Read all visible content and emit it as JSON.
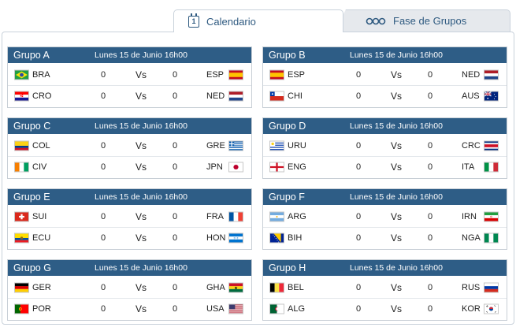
{
  "tabs": {
    "calendar": "Calendario",
    "groups": "Fase de Grupos"
  },
  "vs": "Vs",
  "groups": [
    {
      "name": "Grupo A",
      "date": "Lunes 15 de Junio 16h00",
      "matches": [
        {
          "home": "BRA",
          "home_flag": "brazil-flag-icon",
          "home_score": "0",
          "away_score": "0",
          "away": "ESP",
          "away_flag": "spain-flag-icon"
        },
        {
          "home": "CRO",
          "home_flag": "croatia-flag-icon",
          "home_score": "0",
          "away_score": "0",
          "away": "NED",
          "away_flag": "netherlands-flag-icon"
        }
      ]
    },
    {
      "name": "Grupo B",
      "date": "Lunes 15 de Junio 16h00",
      "matches": [
        {
          "home": "ESP",
          "home_flag": "spain-flag-icon",
          "home_score": "0",
          "away_score": "0",
          "away": "NED",
          "away_flag": "netherlands-flag-icon"
        },
        {
          "home": "CHI",
          "home_flag": "chile-flag-icon",
          "home_score": "0",
          "away_score": "0",
          "away": "AUS",
          "away_flag": "australia-flag-icon"
        }
      ]
    },
    {
      "name": "Grupo C",
      "date": "Lunes 15 de Junio 16h00",
      "matches": [
        {
          "home": "COL",
          "home_flag": "colombia-flag-icon",
          "home_score": "0",
          "away_score": "0",
          "away": "GRE",
          "away_flag": "greece-flag-icon"
        },
        {
          "home": "CIV",
          "home_flag": "ivory-coast-flag-icon",
          "home_score": "0",
          "away_score": "0",
          "away": "JPN",
          "away_flag": "japan-flag-icon"
        }
      ]
    },
    {
      "name": "Grupo D",
      "date": "Lunes 15 de Junio 16h00",
      "matches": [
        {
          "home": "URU",
          "home_flag": "uruguay-flag-icon",
          "home_score": "0",
          "away_score": "0",
          "away": "CRC",
          "away_flag": "costa-rica-flag-icon"
        },
        {
          "home": "ENG",
          "home_flag": "england-flag-icon",
          "home_score": "0",
          "away_score": "0",
          "away": "ITA",
          "away_flag": "italy-flag-icon"
        }
      ]
    },
    {
      "name": "Grupo E",
      "date": "Lunes 15 de Junio 16h00",
      "matches": [
        {
          "home": "SUI",
          "home_flag": "switzerland-flag-icon",
          "home_score": "0",
          "away_score": "0",
          "away": "FRA",
          "away_flag": "france-flag-icon"
        },
        {
          "home": "ECU",
          "home_flag": "ecuador-flag-icon",
          "home_score": "0",
          "away_score": "0",
          "away": "HON",
          "away_flag": "honduras-flag-icon"
        }
      ]
    },
    {
      "name": "Grupo F",
      "date": "Lunes 15 de Junio 16h00",
      "matches": [
        {
          "home": "ARG",
          "home_flag": "argentina-flag-icon",
          "home_score": "0",
          "away_score": "0",
          "away": "IRN",
          "away_flag": "iran-flag-icon"
        },
        {
          "home": "BIH",
          "home_flag": "bosnia-flag-icon",
          "home_score": "0",
          "away_score": "0",
          "away": "NGA",
          "away_flag": "nigeria-flag-icon"
        }
      ]
    },
    {
      "name": "Grupo G",
      "date": "Lunes 15 de Junio 16h00",
      "matches": [
        {
          "home": "GER",
          "home_flag": "germany-flag-icon",
          "home_score": "0",
          "away_score": "0",
          "away": "GHA",
          "away_flag": "ghana-flag-icon"
        },
        {
          "home": "POR",
          "home_flag": "portugal-flag-icon",
          "home_score": "0",
          "away_score": "0",
          "away": "USA",
          "away_flag": "usa-flag-icon"
        }
      ]
    },
    {
      "name": "Grupo H",
      "date": "Lunes 15 de Junio 16h00",
      "matches": [
        {
          "home": "BEL",
          "home_flag": "belgium-flag-icon",
          "home_score": "0",
          "away_score": "0",
          "away": "RUS",
          "away_flag": "russia-flag-icon"
        },
        {
          "home": "ALG",
          "home_flag": "algeria-flag-icon",
          "home_score": "0",
          "away_score": "0",
          "away": "KOR",
          "away_flag": "south-korea-flag-icon"
        }
      ]
    }
  ]
}
